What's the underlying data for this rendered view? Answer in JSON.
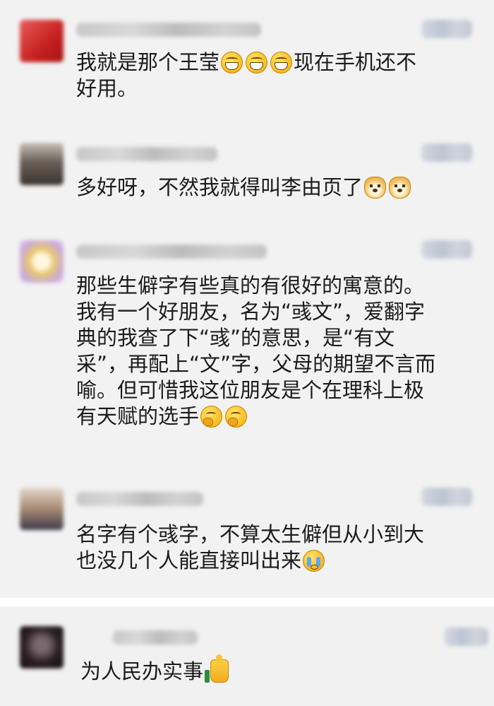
{
  "colors": {
    "panel_bg": "#f2f2f2",
    "text": "#1b1b1b",
    "avatar_1": "#d32f2f",
    "avatar_2": "#5a5048",
    "avatar_3": "#e3c87a",
    "avatar_4": "#8a6f5a",
    "avatar_5": "#2b2024"
  },
  "comments": [
    {
      "lines": [
        {
          "text": "我就是那个王莹",
          "emojis": [
            "grin-emoji",
            "grin-emoji",
            "grin-emoji"
          ],
          "after": "现在手机还不"
        },
        {
          "text": "好用。"
        }
      ]
    },
    {
      "lines": [
        {
          "text": "多好呀，不然我就得叫李由页了",
          "emojis": [
            "doge-emoji",
            "doge-emoji"
          ]
        }
      ]
    },
    {
      "lines": [
        {
          "text": "那些生僻字有些真的有很好的寓意的。"
        },
        {
          "text": "我有一个好朋友，名为“彧文”，爱翻字"
        },
        {
          "text": "典的我查了下“彧”的意思，是“有文"
        },
        {
          "text": "采”，再配上“文”字，父母的期望不言而"
        },
        {
          "text": "喻。但可惜我这位朋友是个在理科上极"
        },
        {
          "text": "有天赋的选手",
          "emojis": [
            "thinking-emoji",
            "thinking-emoji"
          ]
        }
      ]
    },
    {
      "lines": [
        {
          "text": "名字有个彧字，不算太生僻但从小到大"
        },
        {
          "text": "也没几个人能直接叫出来",
          "emojis": [
            "crying-emoji"
          ]
        }
      ]
    },
    {
      "lines": [
        {
          "text": "为人民办实事",
          "emojis": [
            "thumbs-up-emoji"
          ]
        }
      ]
    }
  ]
}
